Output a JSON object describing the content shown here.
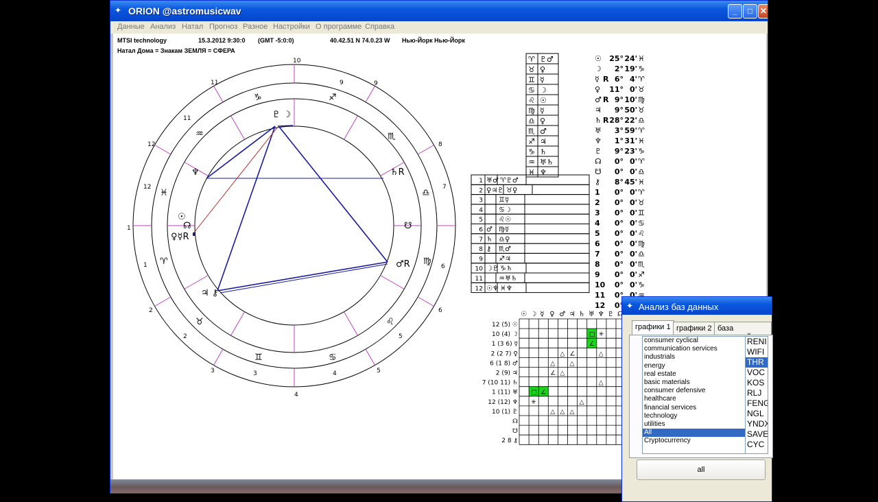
{
  "window": {
    "title": "ORION @astromusicwav",
    "controls": [
      "_",
      "□",
      "✕"
    ],
    "icon": "orion-app-icon"
  },
  "menu": [
    "Данные",
    "Анализ",
    "Натал",
    "Прогноз",
    "Разное",
    "Настройки",
    "О программе",
    "Справка"
  ],
  "info": {
    "company": "MTSI technology",
    "datetime": "15.3.2012 9:30:0",
    "timezone": "(GMT -5:0:0)",
    "coords": "40.42.51 N  74.0.23 W",
    "place": "Нью-Йорк Нью-Йорк",
    "subtitle": "Натал  Дома = Знакам ЗЕМЛЯ = СФЕРА"
  },
  "wheel": {
    "outer_house_numbers": [
      "10",
      "9",
      "9",
      "8",
      "7",
      "6",
      "5",
      "4",
      "3",
      "2",
      "1",
      "12",
      "11"
    ],
    "sign_ring_numbers": [
      "11",
      "12",
      "1",
      "2",
      "3",
      "4",
      "5",
      "6",
      "7",
      "8",
      "9",
      "10"
    ],
    "sign_glyphs": [
      "♑",
      "♐",
      "♏",
      "♎",
      "♍",
      "♌",
      "♋",
      "♊",
      "♉",
      "♈",
      "♓",
      "♒"
    ],
    "planet_labels": {
      "pluto_moon": "♇ ☽",
      "saturn": "♄R",
      "neptune": "♆",
      "sun": "☉",
      "node_north": "☊",
      "venus_mercury": "♀☿R",
      "node_south": "☋",
      "mars": "♂R",
      "jupiter_chiron": "♃ ⚷"
    }
  },
  "rulers_table": [
    [
      "♈",
      "♇♂"
    ],
    [
      "♉",
      "♀"
    ],
    [
      "♊",
      "☿"
    ],
    [
      "♋",
      "☽"
    ],
    [
      "♌",
      "☉"
    ],
    [
      "♍",
      "☿"
    ],
    [
      "♎",
      "♀"
    ],
    [
      "♏",
      "♂"
    ],
    [
      "♐",
      "♃"
    ],
    [
      "♑",
      "♄"
    ],
    [
      "♒",
      "♅♄"
    ],
    [
      "♓",
      "♆"
    ]
  ],
  "houses_table": [
    {
      "n": "1",
      "a": "♅♂",
      "b": "♈♇♂"
    },
    {
      "n": "2",
      "a": "♀♃♇",
      "b": "♉♀"
    },
    {
      "n": "3",
      "a": "",
      "b": "♊☿"
    },
    {
      "n": "4",
      "a": "",
      "b": "♋☽"
    },
    {
      "n": "5",
      "a": "",
      "b": "♌☉"
    },
    {
      "n": "6",
      "a": "♂",
      "b": "♍☿"
    },
    {
      "n": "7",
      "a": "♄",
      "b": "♎♀"
    },
    {
      "n": "8",
      "a": "⚷",
      "b": "♏♂"
    },
    {
      "n": "9",
      "a": "",
      "b": "♐♃"
    },
    {
      "n": "10",
      "a": "☽♇",
      "b": "♑♄"
    },
    {
      "n": "11",
      "a": "",
      "b": "♒♅♄"
    },
    {
      "n": "12",
      "a": "☉♆",
      "b": "♓♆"
    }
  ],
  "positions": [
    {
      "g": "☉",
      "r": "",
      "deg": "25°",
      "min": "24'",
      "s": "♓"
    },
    {
      "g": "☽",
      "r": "",
      "deg": "2°",
      "min": "19'",
      "s": "♑"
    },
    {
      "g": "☿",
      "r": "R",
      "deg": "6°",
      "min": "4'",
      "s": "♈"
    },
    {
      "g": "♀",
      "r": "",
      "deg": "11°",
      "min": "0'",
      "s": "♉"
    },
    {
      "g": "♂",
      "r": "R",
      "deg": "9°",
      "min": "10'",
      "s": "♍"
    },
    {
      "g": "♃",
      "r": "",
      "deg": "9°",
      "min": "50'",
      "s": "♉"
    },
    {
      "g": "♄",
      "r": "R",
      "deg": "28°",
      "min": "22'",
      "s": "♎"
    },
    {
      "g": "♅",
      "r": "",
      "deg": "3°",
      "min": "59'",
      "s": "♈"
    },
    {
      "g": "♆",
      "r": "",
      "deg": "1°",
      "min": "31'",
      "s": "♓"
    },
    {
      "g": "♇",
      "r": "",
      "deg": "9°",
      "min": "23'",
      "s": "♑"
    },
    {
      "g": "☊",
      "r": "",
      "deg": "0°",
      "min": "0'",
      "s": "♈"
    },
    {
      "g": "☋",
      "r": "",
      "deg": "0°",
      "min": "0'",
      "s": "♎"
    },
    {
      "g": "⚷",
      "r": "",
      "deg": "8°",
      "min": "45'",
      "s": "♓"
    },
    {
      "g": "1",
      "r": "",
      "deg": "0°",
      "min": "0'",
      "s": "♈"
    },
    {
      "g": "2",
      "r": "",
      "deg": "0°",
      "min": "0'",
      "s": "♉"
    },
    {
      "g": "3",
      "r": "",
      "deg": "0°",
      "min": "0'",
      "s": "♊"
    },
    {
      "g": "4",
      "r": "",
      "deg": "0°",
      "min": "0'",
      "s": "♋"
    },
    {
      "g": "5",
      "r": "",
      "deg": "0°",
      "min": "0'",
      "s": "♌"
    },
    {
      "g": "6",
      "r": "",
      "deg": "0°",
      "min": "0'",
      "s": "♍"
    },
    {
      "g": "7",
      "r": "",
      "deg": "0°",
      "min": "0'",
      "s": "♎"
    },
    {
      "g": "8",
      "r": "",
      "deg": "0°",
      "min": "0'",
      "s": "♏"
    },
    {
      "g": "9",
      "r": "",
      "deg": "0°",
      "min": "0'",
      "s": "♐"
    },
    {
      "g": "10",
      "r": "",
      "deg": "0°",
      "min": "0'",
      "s": "♑"
    },
    {
      "g": "11",
      "r": "",
      "deg": "0°",
      "min": "0'",
      "s": "♒"
    },
    {
      "g": "12",
      "r": "",
      "deg": "0°",
      "min": "",
      "s": ""
    }
  ],
  "aspect_grid": {
    "col_glyphs": [
      "☉",
      "☽",
      "☿",
      "♀",
      "♂",
      "♃",
      "♄",
      "♅",
      "♆",
      "♇",
      "☊",
      "☋",
      "⚷"
    ],
    "row_labels": [
      "12 (5) ☉",
      "10 (4) ☽",
      "1 (3 6) ☿",
      "2 (2 7) ♀",
      "6 (1 8) ♂",
      "2 (9) ♃",
      "7 (10 11) ♄",
      "1 (11) ♅",
      "12 (12) ♆",
      "10 (1) ♇",
      "☊",
      "☋",
      "2 8 ⚷"
    ],
    "cells": [
      {
        "r": 1,
        "c": 7,
        "sym": "□",
        "green": true
      },
      {
        "r": 1,
        "c": 8,
        "sym": "✳",
        "green": false
      },
      {
        "r": 2,
        "c": 7,
        "sym": "∠",
        "green": true
      },
      {
        "r": 3,
        "c": 4,
        "sym": "△",
        "green": false
      },
      {
        "r": 3,
        "c": 5,
        "sym": "∠",
        "green": false
      },
      {
        "r": 3,
        "c": 8,
        "sym": "△",
        "green": false
      },
      {
        "r": 4,
        "c": 3,
        "sym": "△",
        "green": false
      },
      {
        "r": 4,
        "c": 5,
        "sym": "△",
        "green": false
      },
      {
        "r": 5,
        "c": 3,
        "sym": "∠",
        "green": false
      },
      {
        "r": 5,
        "c": 4,
        "sym": "△",
        "green": false
      },
      {
        "r": 6,
        "c": 8,
        "sym": "△",
        "green": false
      },
      {
        "r": 7,
        "c": 1,
        "sym": "□",
        "green": true
      },
      {
        "r": 7,
        "c": 2,
        "sym": "∠",
        "green": true
      },
      {
        "r": 8,
        "c": 1,
        "sym": "✳",
        "green": false
      },
      {
        "r": 8,
        "c": 6,
        "sym": "△",
        "green": false
      },
      {
        "r": 9,
        "c": 3,
        "sym": "△",
        "green": false
      },
      {
        "r": 9,
        "c": 4,
        "sym": "△",
        "green": false
      },
      {
        "r": 9,
        "c": 5,
        "sym": "△",
        "green": false
      }
    ]
  },
  "dialog": {
    "title": "Анализ баз данных",
    "tabs": [
      "графики 1",
      "графики 2",
      "база компаний"
    ],
    "sectors": [
      "consumer cyclical",
      "communication services",
      "industrials",
      "energy",
      "real estate",
      "basic materials",
      "consumer defensive",
      "healthcare",
      "financial services",
      "technology",
      "utilities",
      "All",
      "Cryptocurrency"
    ],
    "selected_sector": "All",
    "tickers": [
      "RENI",
      "WIFI",
      "THR",
      "VOC",
      "KOS",
      "RLJ",
      "FENG",
      "NGL",
      "YNDX",
      "SAVE",
      "CYC"
    ],
    "selected_ticker": "THR",
    "button": "all"
  }
}
